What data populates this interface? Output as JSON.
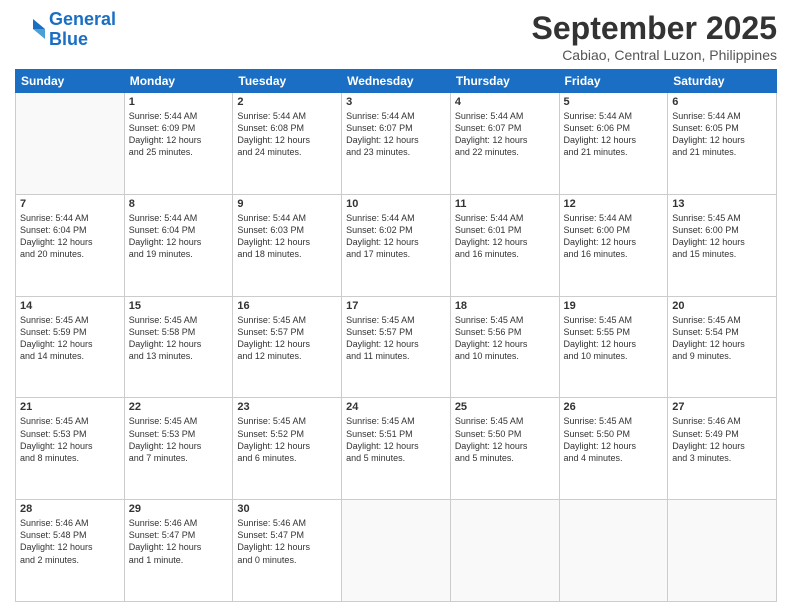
{
  "logo": {
    "line1": "General",
    "line2": "Blue"
  },
  "title": "September 2025",
  "subtitle": "Cabiao, Central Luzon, Philippines",
  "weekdays": [
    "Sunday",
    "Monday",
    "Tuesday",
    "Wednesday",
    "Thursday",
    "Friday",
    "Saturday"
  ],
  "weeks": [
    [
      {
        "day": "",
        "info": ""
      },
      {
        "day": "1",
        "info": "Sunrise: 5:44 AM\nSunset: 6:09 PM\nDaylight: 12 hours\nand 25 minutes."
      },
      {
        "day": "2",
        "info": "Sunrise: 5:44 AM\nSunset: 6:08 PM\nDaylight: 12 hours\nand 24 minutes."
      },
      {
        "day": "3",
        "info": "Sunrise: 5:44 AM\nSunset: 6:07 PM\nDaylight: 12 hours\nand 23 minutes."
      },
      {
        "day": "4",
        "info": "Sunrise: 5:44 AM\nSunset: 6:07 PM\nDaylight: 12 hours\nand 22 minutes."
      },
      {
        "day": "5",
        "info": "Sunrise: 5:44 AM\nSunset: 6:06 PM\nDaylight: 12 hours\nand 21 minutes."
      },
      {
        "day": "6",
        "info": "Sunrise: 5:44 AM\nSunset: 6:05 PM\nDaylight: 12 hours\nand 21 minutes."
      }
    ],
    [
      {
        "day": "7",
        "info": "Sunrise: 5:44 AM\nSunset: 6:04 PM\nDaylight: 12 hours\nand 20 minutes."
      },
      {
        "day": "8",
        "info": "Sunrise: 5:44 AM\nSunset: 6:04 PM\nDaylight: 12 hours\nand 19 minutes."
      },
      {
        "day": "9",
        "info": "Sunrise: 5:44 AM\nSunset: 6:03 PM\nDaylight: 12 hours\nand 18 minutes."
      },
      {
        "day": "10",
        "info": "Sunrise: 5:44 AM\nSunset: 6:02 PM\nDaylight: 12 hours\nand 17 minutes."
      },
      {
        "day": "11",
        "info": "Sunrise: 5:44 AM\nSunset: 6:01 PM\nDaylight: 12 hours\nand 16 minutes."
      },
      {
        "day": "12",
        "info": "Sunrise: 5:44 AM\nSunset: 6:00 PM\nDaylight: 12 hours\nand 16 minutes."
      },
      {
        "day": "13",
        "info": "Sunrise: 5:45 AM\nSunset: 6:00 PM\nDaylight: 12 hours\nand 15 minutes."
      }
    ],
    [
      {
        "day": "14",
        "info": "Sunrise: 5:45 AM\nSunset: 5:59 PM\nDaylight: 12 hours\nand 14 minutes."
      },
      {
        "day": "15",
        "info": "Sunrise: 5:45 AM\nSunset: 5:58 PM\nDaylight: 12 hours\nand 13 minutes."
      },
      {
        "day": "16",
        "info": "Sunrise: 5:45 AM\nSunset: 5:57 PM\nDaylight: 12 hours\nand 12 minutes."
      },
      {
        "day": "17",
        "info": "Sunrise: 5:45 AM\nSunset: 5:57 PM\nDaylight: 12 hours\nand 11 minutes."
      },
      {
        "day": "18",
        "info": "Sunrise: 5:45 AM\nSunset: 5:56 PM\nDaylight: 12 hours\nand 10 minutes."
      },
      {
        "day": "19",
        "info": "Sunrise: 5:45 AM\nSunset: 5:55 PM\nDaylight: 12 hours\nand 10 minutes."
      },
      {
        "day": "20",
        "info": "Sunrise: 5:45 AM\nSunset: 5:54 PM\nDaylight: 12 hours\nand 9 minutes."
      }
    ],
    [
      {
        "day": "21",
        "info": "Sunrise: 5:45 AM\nSunset: 5:53 PM\nDaylight: 12 hours\nand 8 minutes."
      },
      {
        "day": "22",
        "info": "Sunrise: 5:45 AM\nSunset: 5:53 PM\nDaylight: 12 hours\nand 7 minutes."
      },
      {
        "day": "23",
        "info": "Sunrise: 5:45 AM\nSunset: 5:52 PM\nDaylight: 12 hours\nand 6 minutes."
      },
      {
        "day": "24",
        "info": "Sunrise: 5:45 AM\nSunset: 5:51 PM\nDaylight: 12 hours\nand 5 minutes."
      },
      {
        "day": "25",
        "info": "Sunrise: 5:45 AM\nSunset: 5:50 PM\nDaylight: 12 hours\nand 5 minutes."
      },
      {
        "day": "26",
        "info": "Sunrise: 5:45 AM\nSunset: 5:50 PM\nDaylight: 12 hours\nand 4 minutes."
      },
      {
        "day": "27",
        "info": "Sunrise: 5:46 AM\nSunset: 5:49 PM\nDaylight: 12 hours\nand 3 minutes."
      }
    ],
    [
      {
        "day": "28",
        "info": "Sunrise: 5:46 AM\nSunset: 5:48 PM\nDaylight: 12 hours\nand 2 minutes."
      },
      {
        "day": "29",
        "info": "Sunrise: 5:46 AM\nSunset: 5:47 PM\nDaylight: 12 hours\nand 1 minute."
      },
      {
        "day": "30",
        "info": "Sunrise: 5:46 AM\nSunset: 5:47 PM\nDaylight: 12 hours\nand 0 minutes."
      },
      {
        "day": "",
        "info": ""
      },
      {
        "day": "",
        "info": ""
      },
      {
        "day": "",
        "info": ""
      },
      {
        "day": "",
        "info": ""
      }
    ]
  ]
}
